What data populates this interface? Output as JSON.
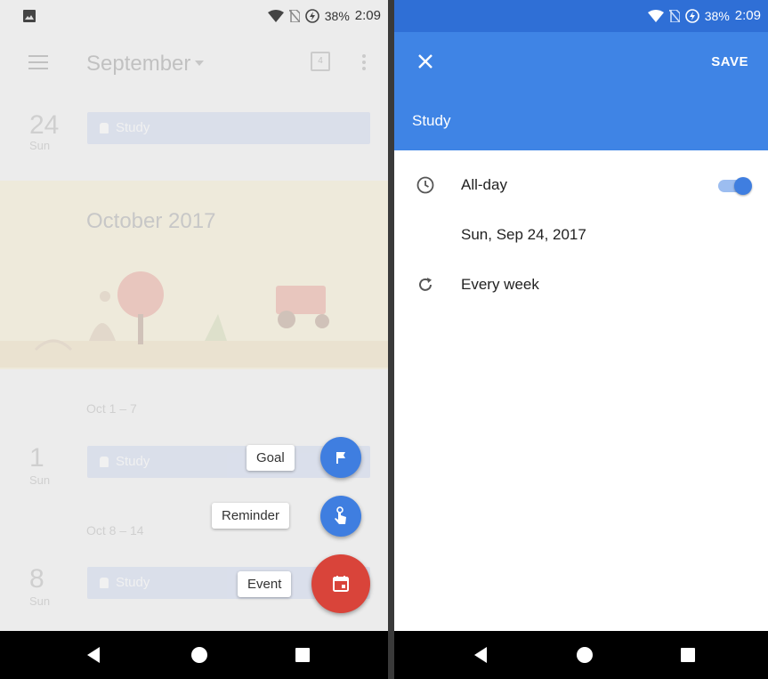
{
  "left_screen": {
    "status": {
      "battery": "38%",
      "time": "2:09"
    },
    "toolbar": {
      "month_title": "September",
      "today_number": "4"
    },
    "days": [
      {
        "num": "24",
        "dow": "Sun",
        "event": "Study"
      },
      {
        "num": "1",
        "dow": "Sun",
        "event": "Study"
      },
      {
        "num": "8",
        "dow": "Sun",
        "event": "Study"
      }
    ],
    "month_banner": "October 2017",
    "weeks": [
      "Oct 1 – 7",
      "Oct 8 – 14"
    ],
    "fab_menu": {
      "goal": "Goal",
      "reminder": "Reminder",
      "event": "Event"
    }
  },
  "right_screen": {
    "status": {
      "battery": "38%",
      "time": "2:09"
    },
    "toolbar": {
      "save_label": "SAVE"
    },
    "title": "Study",
    "all_day_label": "All-day",
    "all_day_on": true,
    "date": "Sun, Sep 24, 2017",
    "repeat": "Every week"
  },
  "colors": {
    "primary": "#3f84e5",
    "status_bar": "#2f6fd6",
    "fab_event": "#d9443a",
    "fab_small": "#3f7ee0",
    "event_chip": "#aebfe8",
    "banner": "#f5e6b0"
  },
  "icons": {
    "status": [
      "image-icon",
      "wifi-icon",
      "no-sim-icon",
      "battery-charging-icon"
    ],
    "editor": [
      "close-icon",
      "clock-icon",
      "repeat-icon"
    ],
    "fab": [
      "flag-icon",
      "reminder-hand-icon",
      "calendar-event-icon"
    ],
    "nav": [
      "back-icon",
      "home-icon",
      "recents-icon"
    ]
  }
}
